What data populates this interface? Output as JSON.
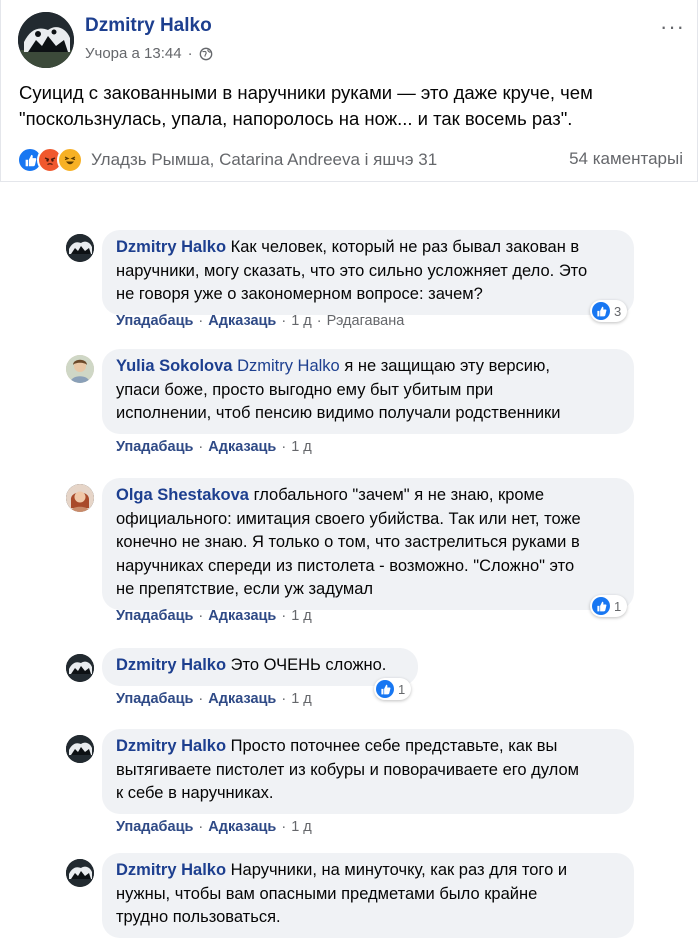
{
  "post": {
    "author": "Dzmitry Halko",
    "time": "Учора а 13:44",
    "dot": "·",
    "more": "···",
    "text_line1": "Суицид с закованными в наручники руками — это даже круче, чем",
    "text_line2": "\"поскользнулась, упала, напоролось на нож... и так восемь раз\".",
    "reactions_text": "Уладзь Рымша, Catarina Andreeva і яшчэ 31",
    "comments_count": "54 каментарыі",
    "reaction_icons": [
      "like-icon",
      "angry-icon",
      "haha-icon"
    ]
  },
  "actions": {
    "like": "Упадабаць",
    "reply": "Адказаць",
    "sep": "·"
  },
  "comments": [
    {
      "author": "Dzmitry Halko",
      "mention": "",
      "lines": [
        "Как человек, который не раз бывал закован в",
        "наручники, могу сказать, что это сильно усложняет дело. Это",
        "не говоря уже о закономерном вопросе: зачем?"
      ],
      "time": "1 д",
      "edited": "Рэдагавана",
      "likes": "3"
    },
    {
      "author": "Yulia Sokolova",
      "mention": "Dzmitry Halko",
      "lines": [
        "я не защищаю эту версию,",
        "упаси боже, просто выгодно ему быт убитым при",
        "исполнении, чтоб пенсию видимо получали родственники"
      ],
      "time": "1 д"
    },
    {
      "author": "Olga Shestakova",
      "mention": "",
      "lines": [
        "глобального \"зачем\" я не знаю, кроме",
        "официального: имитация своего убийства. Так или нет, тоже",
        "конечно не знаю. Я только о том, что застрелиться руками в",
        "наручниках спереди из пистолета - возможно. \"Сложно\" это",
        "не препятствие, если уж задумал"
      ],
      "time": "1 д",
      "likes": "1"
    },
    {
      "author": "Dzmitry Halko",
      "mention": "",
      "lines": [
        "Это ОЧЕНЬ сложно."
      ],
      "time": "1 д",
      "likes": "1"
    },
    {
      "author": "Dzmitry Halko",
      "mention": "",
      "lines": [
        "Просто поточнее себе представьте, как вы",
        "вытягиваете пистолет из кобуры и поворачиваете его дулом",
        "к себе в наручниках."
      ],
      "time": "1 д"
    },
    {
      "author": "Dzmitry Halko",
      "mention": "",
      "lines": [
        "Наручники, на минуточку, как раз для того и",
        "нужны, чтобы вам опасными предметами было крайне",
        "трудно пользоваться."
      ]
    }
  ],
  "colors": {
    "name_blue": "#1d3f8f",
    "bubble_bg": "#f0f2f5",
    "meta_gray": "#65676b",
    "like_blue": "#1877f2"
  }
}
